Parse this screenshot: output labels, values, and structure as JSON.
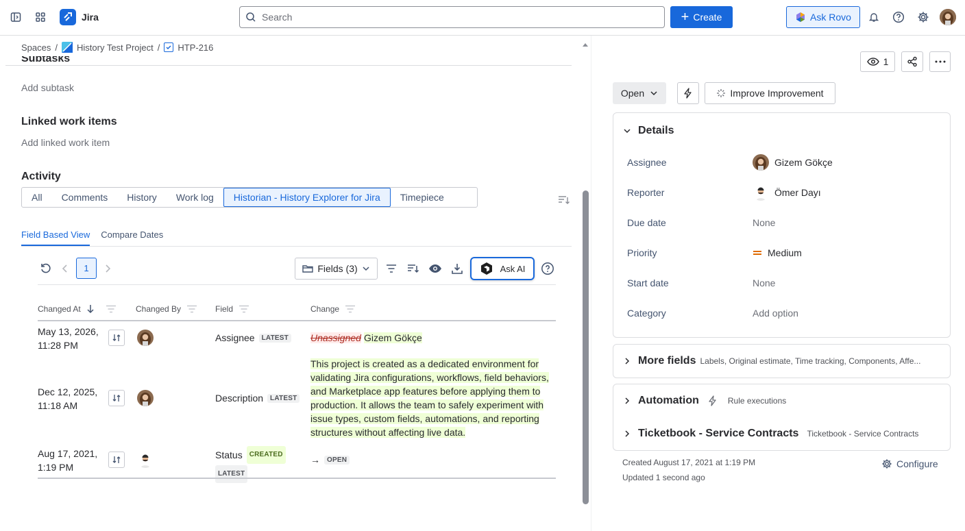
{
  "app": {
    "name": "Jira"
  },
  "search": {
    "placeholder": "Search"
  },
  "topbar": {
    "create_label": "Create",
    "ask_rovo_label": "Ask Rovo"
  },
  "breadcrumb": {
    "spaces": "Spaces",
    "project": "History Test Project",
    "issue_key": "HTP-216",
    "sep": "/"
  },
  "sections": {
    "subtasks_title": "Subtasks",
    "add_subtask": "Add subtask",
    "linked_title": "Linked work items",
    "add_linked": "Add linked work item",
    "activity_title": "Activity"
  },
  "activity_tabs": [
    "All",
    "Comments",
    "History",
    "Work log",
    "Historian - History Explorer for Jira",
    "Timepiece"
  ],
  "selected_activity_tab": "Historian - History Explorer for Jira",
  "subtabs": [
    "Field Based View",
    "Compare Dates"
  ],
  "toolbar": {
    "page": "1",
    "fields_label": "Fields (3)",
    "ask_ai_label": "Ask AI"
  },
  "table": {
    "headers": [
      "Changed At",
      "Changed By",
      "Field",
      "Change"
    ],
    "rows": [
      {
        "date": "May 13, 2026,",
        "time": "11:28 PM",
        "field": "Assignee",
        "badges": [
          "LATEST"
        ],
        "old": "Unassigned",
        "new": "Gizem Gökçe"
      },
      {
        "date": "Dec 12, 2025,",
        "time": "11:18 AM",
        "field": "Description",
        "badges": [
          "LATEST"
        ],
        "new_lines": [
          "This project is created as a dedicated environment for",
          "validating Jira configurations, workflows, field behaviors,",
          "and Marketplace app features before applying them to",
          "production. It allows the team to safely experiment with",
          "issue types, custom fields, automations, and reporting",
          "structures without affecting live data."
        ]
      },
      {
        "date": "Aug 17, 2021,",
        "time": "1:19 PM",
        "field": "Status",
        "badges": [
          "CREATED",
          "LATEST"
        ],
        "arrow": "→",
        "new_status": "OPEN"
      }
    ]
  },
  "right": {
    "watchers": "1",
    "status_label": "Open",
    "improve_label": "Improve Improvement",
    "details_title": "Details",
    "fields": [
      {
        "label": "Assignee",
        "value": "Gizem Gökçe"
      },
      {
        "label": "Reporter",
        "value": "Ömer Dayı"
      },
      {
        "label": "Due date",
        "value": "None"
      },
      {
        "label": "Priority",
        "value": "Medium"
      },
      {
        "label": "Start date",
        "value": "None"
      },
      {
        "label": "Category",
        "value": "Add option"
      }
    ],
    "more_fields_title": "More fields",
    "more_fields_sub": "Labels, Original estimate, Time tracking, Components, Affe...",
    "automation_title": "Automation",
    "automation_sub": "Rule executions",
    "ticketbook_title": "Ticketbook - Service Contracts",
    "ticketbook_sub": "Ticketbook - Service Contracts",
    "created": "Created August 17, 2021 at 1:19 PM",
    "updated": "Updated 1 second ago",
    "configure_label": "Configure"
  },
  "colors": {
    "primary": "#1868db",
    "insert_bg": "#efffd6",
    "delete_bg": "#ffeceb",
    "priority_medium": "#e06c00"
  }
}
